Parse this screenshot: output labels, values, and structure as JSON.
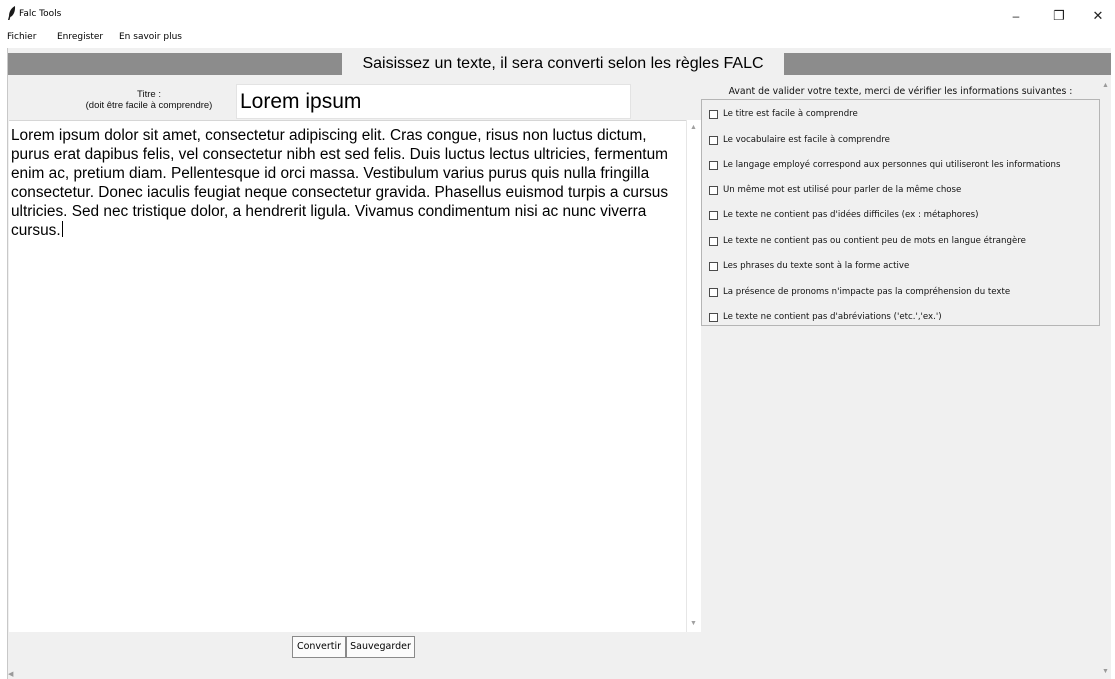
{
  "window": {
    "title": "Falc Tools",
    "minimize_glyph": "–",
    "maximize_glyph": "❐",
    "close_glyph": "✕"
  },
  "menu": {
    "items": [
      "Fichier",
      "Enregister",
      "En savoir plus"
    ]
  },
  "header": {
    "instruction": "Saisissez un texte, il sera converti selon les règles FALC"
  },
  "editor": {
    "title_label_line1": "Titre :",
    "title_label_line2": "(doit être facile à comprendre)",
    "title_value": "Lorem ipsum",
    "body_text": "Lorem ipsum dolor sit amet, consectetur adipiscing elit. Cras congue, risus non luctus dictum, purus erat dapibus felis, vel consectetur nibh est sed felis. Duis luctus lectus ultricies, fermentum enim ac, pretium diam. Pellentesque id orci massa. Vestibulum varius purus quis nulla fringilla consectetur. Donec iaculis feugiat neque consectetur gravida. Phasellus euismod turpis a cursus ultricies. Sed nec tristique dolor, a hendrerit ligula. Vivamus condimentum nisi ac nunc viverra cursus."
  },
  "buttons": {
    "convert": "Convertir",
    "save": "Sauvegarder"
  },
  "checklist": {
    "header": "Avant de valider votre texte, merci de vérifier les informations suivantes :",
    "items": [
      {
        "label": "Le titre est facile à comprendre",
        "checked": false
      },
      {
        "label": "Le vocabulaire est facile à comprendre",
        "checked": false
      },
      {
        "label": "Le langage employé correspond aux personnes qui utiliseront les informations",
        "checked": false
      },
      {
        "label": "Un même mot est utilisé pour parler de la même chose",
        "checked": false
      },
      {
        "label": "Le texte ne contient pas d'idées difficiles (ex : métaphores)",
        "checked": false
      },
      {
        "label": "Le texte ne contient pas ou contient peu de mots en langue étrangère",
        "checked": false
      },
      {
        "label": "Les phrases du texte sont à la forme active",
        "checked": false
      },
      {
        "label": "La présence de pronoms n'impacte pas la compréhension du texte",
        "checked": false
      },
      {
        "label": "Le texte ne contient pas d'abréviations ('etc.','ex.')",
        "checked": false
      }
    ]
  },
  "colors": {
    "header_bar": "#8c8c8c",
    "frame_bg": "#f0f0f0"
  }
}
